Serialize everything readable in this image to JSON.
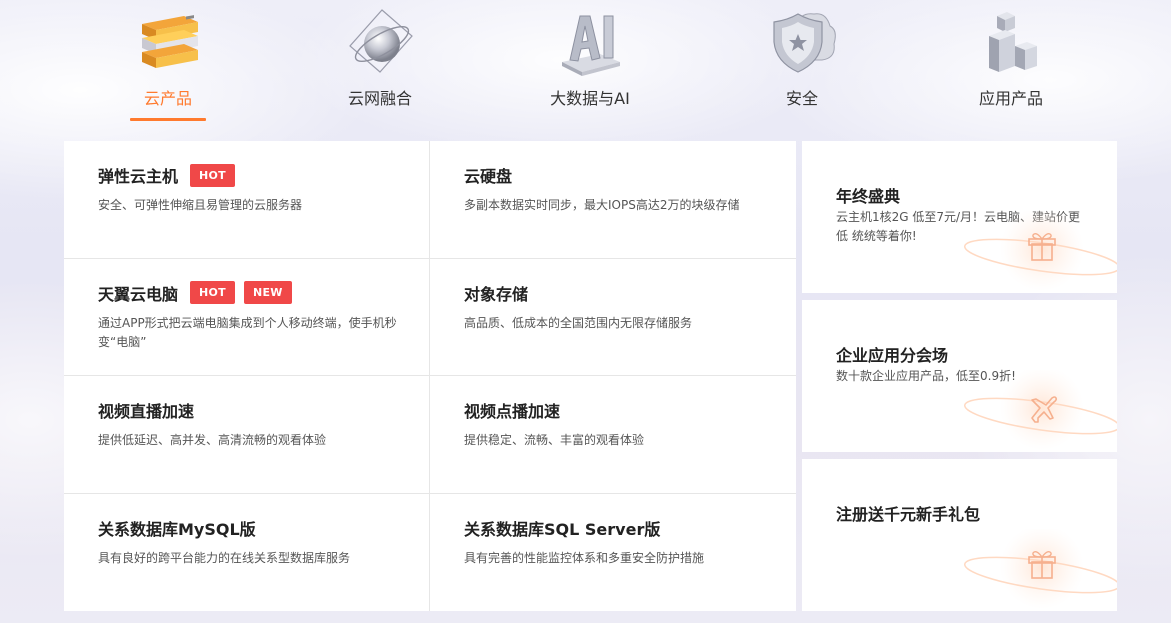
{
  "tabs": [
    {
      "label": "云产品",
      "icon": "server-stack-icon",
      "active": true
    },
    {
      "label": "云网融合",
      "icon": "globe-orbit-icon",
      "active": false
    },
    {
      "label": "大数据与AI",
      "icon": "ai-letters-icon",
      "active": false
    },
    {
      "label": "安全",
      "icon": "shield-cloud-icon",
      "active": false
    },
    {
      "label": "应用产品",
      "icon": "building-blocks-icon",
      "active": false
    }
  ],
  "products": [
    {
      "title": "弹性云主机",
      "badges": [
        "HOT"
      ],
      "desc": "安全、可弹性伸缩且易管理的云服务器"
    },
    {
      "title": "云硬盘",
      "badges": [],
      "desc": "多副本数据实时同步，最大IOPS高达2万的块级存储"
    },
    {
      "title": "天翼云电脑",
      "badges": [
        "HOT",
        "NEW"
      ],
      "desc": "通过APP形式把云端电脑集成到个人移动终端，使手机秒变“电脑”"
    },
    {
      "title": "对象存储",
      "badges": [],
      "desc": "高品质、低成本的全国范围内无限存储服务"
    },
    {
      "title": "视频直播加速",
      "badges": [],
      "desc": "提供低延迟、高并发、高清流畅的观看体验"
    },
    {
      "title": "视频点播加速",
      "badges": [],
      "desc": "提供稳定、流畅、丰富的观看体验"
    },
    {
      "title": "关系数据库MySQL版",
      "badges": [],
      "desc": "具有良好的跨平台能力的在线关系型数据库服务"
    },
    {
      "title": "关系数据库SQL Server版",
      "badges": [],
      "desc": "具有完善的性能监控体系和多重安全防护措施"
    }
  ],
  "promos": [
    {
      "title": "年终盛典",
      "desc": "云主机1核2G 低至7元/月！云电脑、建站价更低 统统等着你!",
      "icon": "gift-icon"
    },
    {
      "title": "企业应用分会场",
      "desc": "数十款企业应用产品，低至0.9折!",
      "icon": "airplane-icon"
    },
    {
      "title": "注册送千元新手礼包",
      "desc": "",
      "icon": "gift-icon"
    }
  ],
  "colors": {
    "accent": "#ff7a2e",
    "badge": "#f04848"
  }
}
